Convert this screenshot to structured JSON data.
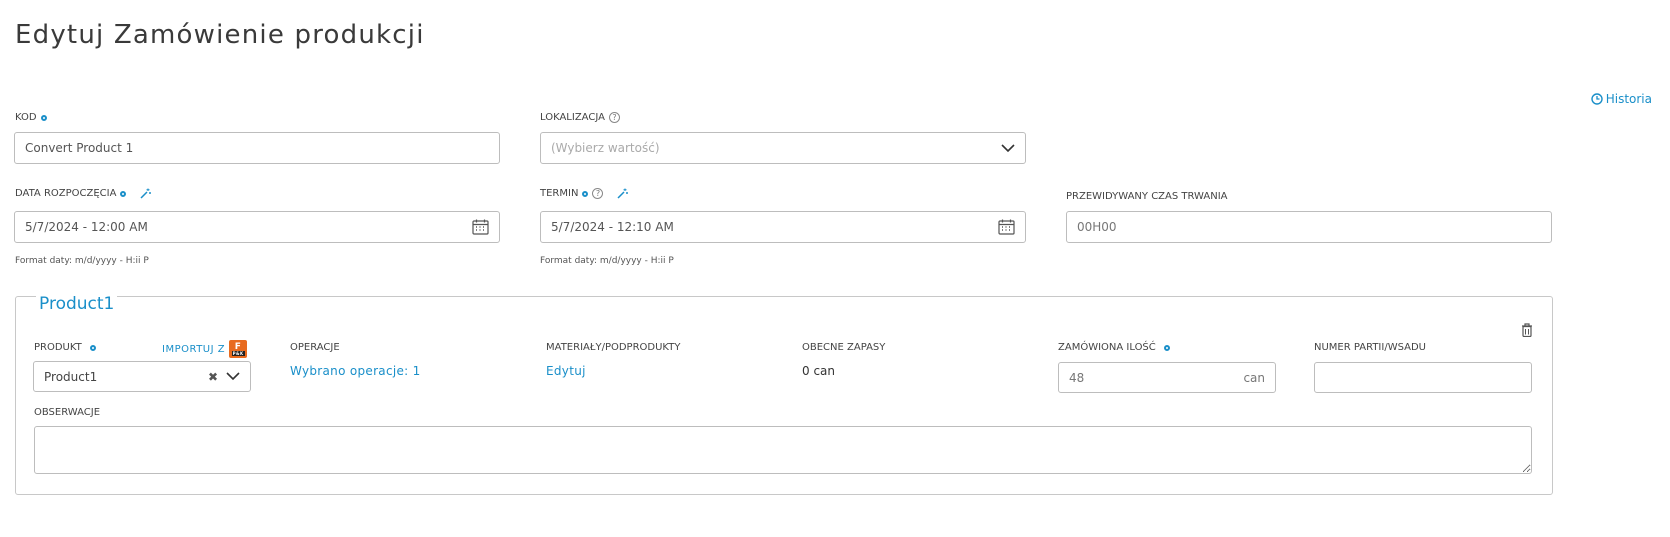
{
  "page": {
    "title": "Edytuj Zamówienie produkcji"
  },
  "history": {
    "label": "Historia",
    "icon": "clock-icon"
  },
  "fields": {
    "kod": {
      "label": "KOD",
      "value": "Convert Product 1"
    },
    "lokalizacja": {
      "label": "LOKALIZACJA",
      "placeholder": "(Wybierz wartość)"
    },
    "data_rozpoczecia": {
      "label": "DATA ROZPOCZĘCIA",
      "value": "5/7/2024 - 12:00 AM",
      "hint": "Format daty: m/d/yyyy - H:ii P"
    },
    "termin": {
      "label": "TERMIN",
      "value": "5/7/2024 - 12:10 AM",
      "hint": "Format daty: m/d/yyyy - H:ii P"
    },
    "czas_trwania": {
      "label": "PRZEWIDYWANY CZAS TRWANIA",
      "value": "00H00"
    }
  },
  "product_section": {
    "legend": "Product1",
    "produkt": {
      "label": "PRODUKT",
      "value": "Product1",
      "import_label": "IMPORTUJ Z",
      "import_badge": "F",
      "import_badge_sub": "P&K"
    },
    "operacje": {
      "label": "OPERACJE",
      "link": "Wybrano operacje: 1"
    },
    "materialy": {
      "label": "MATERIAŁY/PODPRODUKTY",
      "link": "Edytuj"
    },
    "zapasy": {
      "label": "OBECNE ZAPASY",
      "value": "0 can"
    },
    "ilosc": {
      "label": "ZAMÓWIONA ILOŚĆ",
      "value": "48",
      "unit": "can"
    },
    "partia": {
      "label": "NUMER PARTII/WSADU",
      "value": ""
    },
    "obserwacje": {
      "label": "OBSERWACJE",
      "value": ""
    }
  },
  "colors": {
    "accent": "#1a8fc9",
    "border": "#bdbdbd",
    "badge": "#e86b1f"
  }
}
